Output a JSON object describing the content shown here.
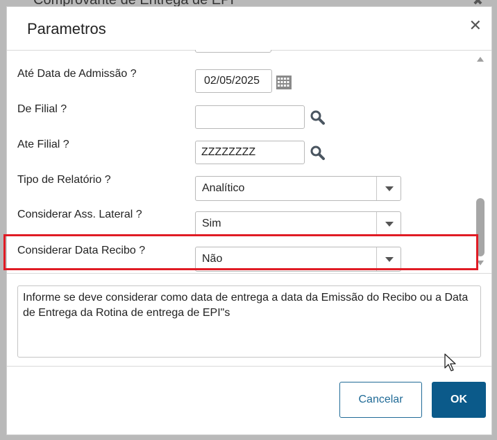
{
  "background": {
    "title": "Comprovante de Entrega de EPI",
    "close_glyph": "✖"
  },
  "dialog": {
    "title": "Parametros",
    "close_glyph": "✕"
  },
  "form": {
    "rows": [
      {
        "label": "Até Data de Admissão ?",
        "value": "02/05/2025",
        "type": "date"
      },
      {
        "label": "De Filial ?",
        "value": "",
        "type": "text-search"
      },
      {
        "label": "Ate Filial ?",
        "value": "ZZZZZZZZ",
        "type": "text-search"
      },
      {
        "label": "Tipo de Relatório ?",
        "value": "Analítico",
        "type": "select"
      },
      {
        "label": "Considerar Ass. Lateral ?",
        "value": "Sim",
        "type": "select"
      },
      {
        "label": "Considerar Data Recibo ?",
        "value": "Não",
        "type": "select"
      }
    ]
  },
  "help": {
    "text": "Informe se deve considerar como data de entrega a data da Emissão do Recibo ou a Data de Entrega da Rotina de entrega de EPI\"s"
  },
  "buttons": {
    "cancel": "Cancelar",
    "ok": "OK"
  },
  "colors": {
    "primary": "#0b5a8a",
    "highlight": "#e01b24"
  }
}
